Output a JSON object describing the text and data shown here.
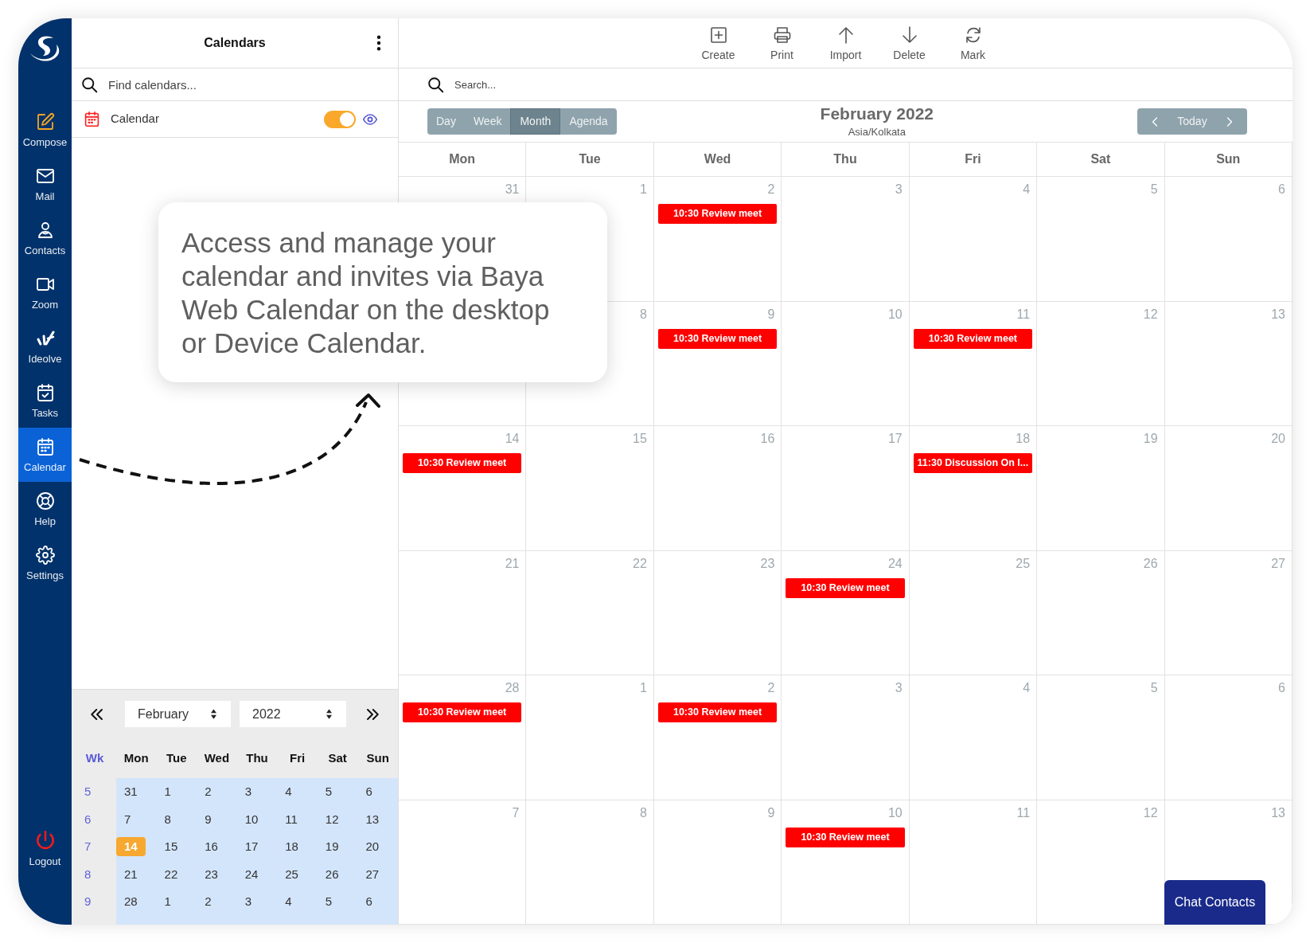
{
  "sidebar": {
    "items": [
      {
        "label": "Compose",
        "kind": "compose",
        "selected": false
      },
      {
        "label": "Mail",
        "kind": "mail",
        "selected": false
      },
      {
        "label": "Contacts",
        "kind": "contacts",
        "selected": false
      },
      {
        "label": "Zoom",
        "kind": "zoom",
        "selected": false
      },
      {
        "label": "Ideolve",
        "kind": "ideolve",
        "selected": false
      },
      {
        "label": "Tasks",
        "kind": "tasks",
        "selected": false
      },
      {
        "label": "Calendar",
        "kind": "calendar",
        "selected": true
      },
      {
        "label": "Help",
        "kind": "help",
        "selected": false
      },
      {
        "label": "Settings",
        "kind": "settings",
        "selected": false
      }
    ],
    "logout": {
      "label": "Logout"
    }
  },
  "calendars_panel": {
    "title": "Calendars",
    "search": {
      "placeholder": "Find calendars..."
    },
    "calendars": [
      {
        "name": "Calendar",
        "on": true
      }
    ],
    "mini_calendar": {
      "month": "February",
      "year": "2022",
      "week_label": "Wk",
      "weekdays": [
        "Mon",
        "Tue",
        "Wed",
        "Thu",
        "Fri",
        "Sat",
        "Sun"
      ],
      "weeks": [
        {
          "week": "5",
          "days": [
            {
              "day": "31",
              "selected": false
            },
            {
              "day": "1",
              "selected": false
            },
            {
              "day": "2",
              "selected": false
            },
            {
              "day": "3",
              "selected": false
            },
            {
              "day": "4",
              "selected": false
            },
            {
              "day": "5",
              "selected": false
            },
            {
              "day": "6",
              "selected": false
            }
          ]
        },
        {
          "week": "6",
          "days": [
            {
              "day": "7",
              "selected": false
            },
            {
              "day": "8",
              "selected": false
            },
            {
              "day": "9",
              "selected": false
            },
            {
              "day": "10",
              "selected": false
            },
            {
              "day": "11",
              "selected": false
            },
            {
              "day": "12",
              "selected": false
            },
            {
              "day": "13",
              "selected": false
            }
          ]
        },
        {
          "week": "7",
          "days": [
            {
              "day": "14",
              "selected": true
            },
            {
              "day": "15",
              "selected": false
            },
            {
              "day": "16",
              "selected": false
            },
            {
              "day": "17",
              "selected": false
            },
            {
              "day": "18",
              "selected": false
            },
            {
              "day": "19",
              "selected": false
            },
            {
              "day": "20",
              "selected": false
            }
          ]
        },
        {
          "week": "8",
          "days": [
            {
              "day": "21",
              "selected": false
            },
            {
              "day": "22",
              "selected": false
            },
            {
              "day": "23",
              "selected": false
            },
            {
              "day": "24",
              "selected": false
            },
            {
              "day": "25",
              "selected": false
            },
            {
              "day": "26",
              "selected": false
            },
            {
              "day": "27",
              "selected": false
            }
          ]
        },
        {
          "week": "9",
          "days": [
            {
              "day": "28",
              "selected": false
            },
            {
              "day": "1",
              "selected": false
            },
            {
              "day": "2",
              "selected": false
            },
            {
              "day": "3",
              "selected": false
            },
            {
              "day": "4",
              "selected": false
            },
            {
              "day": "5",
              "selected": false
            },
            {
              "day": "6",
              "selected": false
            }
          ]
        }
      ]
    }
  },
  "toolbar": {
    "buttons": [
      {
        "label": "Create",
        "kind": "create"
      },
      {
        "label": "Print",
        "kind": "print"
      },
      {
        "label": "Import",
        "kind": "import"
      },
      {
        "label": "Delete",
        "kind": "delete"
      },
      {
        "label": "Mark",
        "kind": "mark"
      }
    ]
  },
  "search": {
    "placeholder": "Search..."
  },
  "view_tabs": [
    {
      "label": "Day",
      "selected": false
    },
    {
      "label": "Week",
      "selected": false
    },
    {
      "label": "Month",
      "selected": true
    },
    {
      "label": "Agenda",
      "selected": false
    }
  ],
  "header": {
    "title": "February 2022",
    "timezone": "Asia/Kolkata",
    "today": "Today"
  },
  "month_grid": {
    "weekdays": [
      "Mon",
      "Tue",
      "Wed",
      "Thu",
      "Fri",
      "Sat",
      "Sun"
    ],
    "weeks": [
      {
        "days": [
          {
            "day": "31"
          },
          {
            "day": "1"
          },
          {
            "day": "2",
            "events": [
              "10:30 Review meet"
            ]
          },
          {
            "day": "3"
          },
          {
            "day": "4"
          },
          {
            "day": "5"
          },
          {
            "day": "6"
          }
        ]
      },
      {
        "days": [
          {
            "day": "8"
          },
          {
            "day": "9",
            "events": [
              "10:30 Review meet"
            ]
          },
          {
            "day": "10"
          },
          {
            "day": "11",
            "events": [
              "10:30 Review meet"
            ]
          },
          {
            "day": "12"
          },
          {
            "day": "13"
          }
        ]
      },
      {
        "days": [
          {
            "day": "14",
            "events": [
              "10:30 Review meet"
            ]
          },
          {
            "day": "15"
          },
          {
            "day": "16"
          },
          {
            "day": "17"
          },
          {
            "day": "18",
            "events": [
              "11:30 Discussion On I..."
            ]
          },
          {
            "day": "19"
          },
          {
            "day": "20"
          }
        ]
      },
      {
        "days": [
          {
            "day": "21"
          },
          {
            "day": "22"
          },
          {
            "day": "23"
          },
          {
            "day": "24",
            "events": [
              "10:30 Review meet"
            ]
          },
          {
            "day": "25"
          },
          {
            "day": "26"
          },
          {
            "day": "27"
          }
        ]
      },
      {
        "days": [
          {
            "day": "28",
            "events": [
              "10:30 Review meet"
            ]
          },
          {
            "day": "1"
          },
          {
            "day": "2",
            "events": [
              "10:30 Review meet"
            ]
          },
          {
            "day": "3"
          },
          {
            "day": "4"
          },
          {
            "day": "5"
          },
          {
            "day": "6"
          }
        ]
      },
      {
        "days": [
          {
            "day": "7"
          },
          {
            "day": "8"
          },
          {
            "day": "9"
          },
          {
            "day": "10",
            "events": [
              "10:30 Review meet"
            ]
          },
          {
            "day": "11"
          },
          {
            "day": "12"
          },
          {
            "day": "13"
          }
        ]
      }
    ]
  },
  "callout": {
    "text": "Access and manage your calendar and invites via Baya Web Calendar on the desktop or Device Calendar."
  },
  "chat_button": {
    "label": "Chat Contacts"
  }
}
